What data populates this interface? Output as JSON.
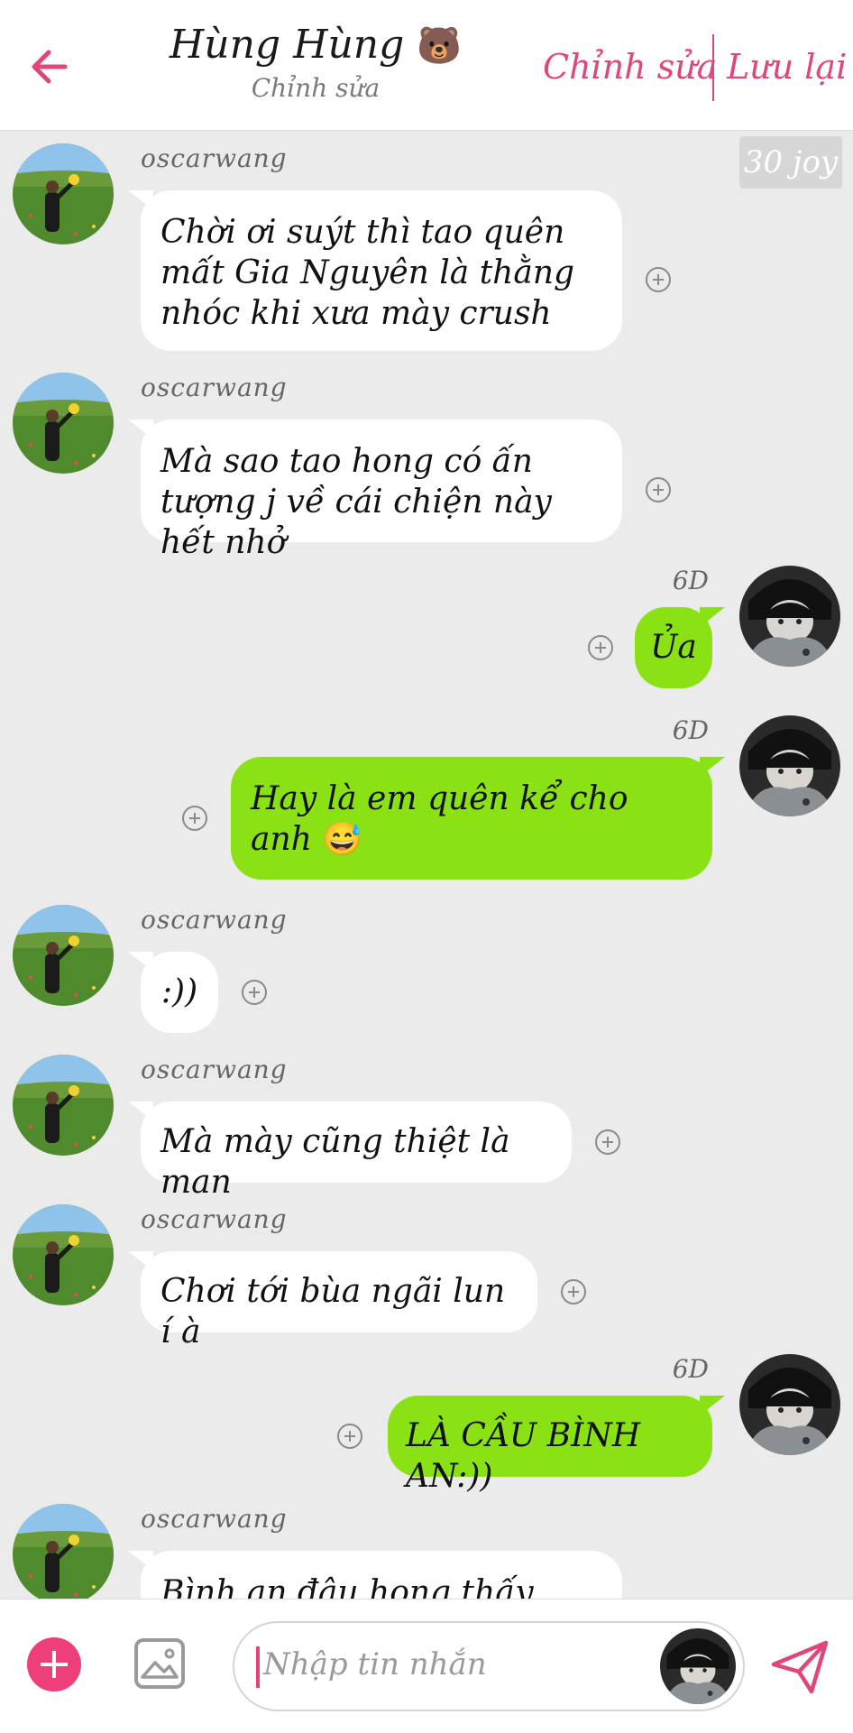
{
  "header": {
    "title": "Hùng Hùng",
    "title_emoji": "🐻",
    "subtitle": "Chỉnh sửa",
    "edit_label": "Chỉnh sửa",
    "save_label": "Lưu lại",
    "accent_color": "#e0457b"
  },
  "chat": {
    "badge": "30 joy",
    "messages": [
      {
        "side": "other",
        "sender": "oscarwang",
        "text": "Chời ơi suýt thì tao quên mất Gia Nguyên là thằng nhóc khi xưa mày crush"
      },
      {
        "side": "other",
        "sender": "oscarwang",
        "text": "Mà sao tao hong có ấn tượng j về cái chiện này hết nhở"
      },
      {
        "side": "me",
        "meta": "6D",
        "text": "Ủa"
      },
      {
        "side": "me",
        "meta": "6D",
        "text": "Hay là em quên kể cho anh",
        "emoji": "😅"
      },
      {
        "side": "other",
        "sender": "oscarwang",
        "text": ":))"
      },
      {
        "side": "other",
        "sender": "oscarwang",
        "text": "Mà mày cũng thiệt là man"
      },
      {
        "side": "other",
        "sender": "oscarwang",
        "text": "Chơi tới bùa ngãi lun í à"
      },
      {
        "side": "me",
        "meta": "6D",
        "text": "LÀ CẦU BÌNH AN:))"
      },
      {
        "side": "other",
        "sender": "oscarwang",
        "text": "Bình an đâu hong thấy chứ"
      }
    ]
  },
  "composer": {
    "placeholder": "Nhập tin nhắn",
    "add_icon": "plus-circle-icon",
    "image_icon": "image-icon",
    "send_icon": "paper-plane-icon"
  },
  "colors": {
    "my_bubble": "#8ae214",
    "other_bubble": "#ffffff",
    "background": "#ebebeb",
    "add_button": "#ef3f7a"
  }
}
